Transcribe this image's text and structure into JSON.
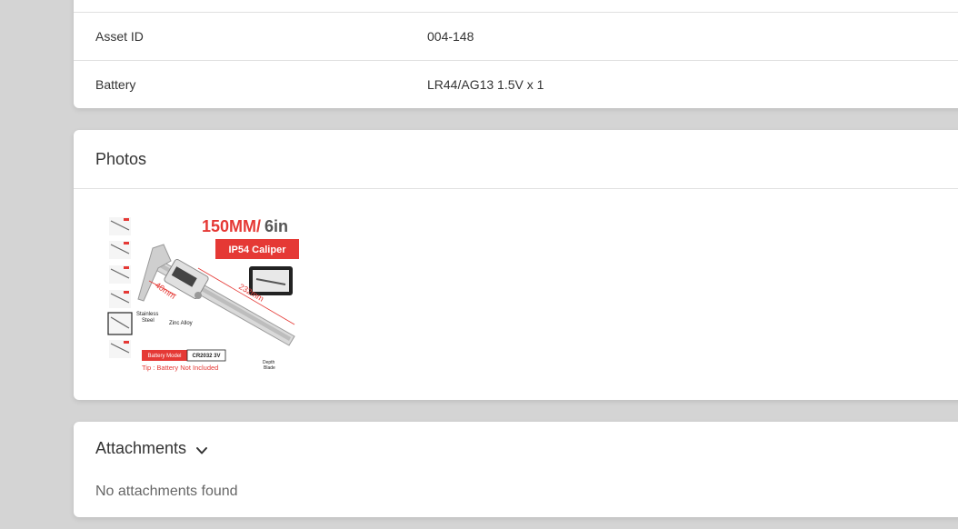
{
  "details": {
    "rows": [
      {
        "label": "Asset ID",
        "value": "004-148"
      },
      {
        "label": "Battery",
        "value": "LR44/AG13 1.5V x 1"
      }
    ]
  },
  "photos": {
    "title": "Photos",
    "image": {
      "headline_size": "150MM/",
      "headline_in": "6in",
      "banner": "IP54 Caliper",
      "dim_length": "232mm",
      "dim_jaw": "40mm",
      "label_steel": "Stainless",
      "label_steel2": "Steel",
      "label_zinc": "Zinc Alloy",
      "label_depth": "Depth",
      "label_depth2": "Blade",
      "battery_model_label": "Battery Model",
      "battery_model_value": "CR2032 3V",
      "tip": "Tip : Battery Not Included",
      "accent_color": "#e53935"
    }
  },
  "attachments": {
    "title": "Attachments",
    "empty": "No attachments found"
  }
}
